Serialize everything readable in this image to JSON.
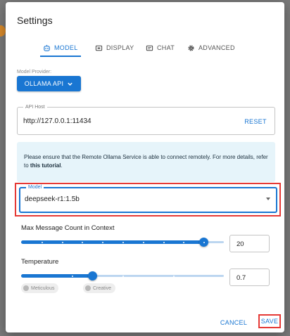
{
  "dialog": {
    "title": "Settings"
  },
  "tabs": [
    {
      "label": "MODEL",
      "icon": "robot-icon",
      "active": true
    },
    {
      "label": "DISPLAY",
      "icon": "monitor-icon",
      "active": false
    },
    {
      "label": "CHAT",
      "icon": "chat-icon",
      "active": false
    },
    {
      "label": "ADVANCED",
      "icon": "gear-icon",
      "active": false
    }
  ],
  "provider": {
    "label": "Model Provider:",
    "button_label": "OLLAMA API"
  },
  "api_host": {
    "legend": "API Host",
    "value": "http://127.0.0.1:11434",
    "reset_label": "RESET"
  },
  "info": {
    "text": "Please ensure that the Remote Ollama Service is able to connect remotely. For more details, refer to ",
    "link": "this tutorial",
    "suffix": "."
  },
  "model": {
    "legend": "Model",
    "value": "deepseek-r1:1.5b"
  },
  "context": {
    "label": "Max Message Count in Context",
    "value": "20",
    "fraction": 0.9
  },
  "temperature": {
    "label": "Temperature",
    "value": "0.7",
    "fraction": 0.35,
    "chips": [
      "Meticulous",
      "Creative"
    ]
  },
  "footer": {
    "cancel_label": "CANCEL",
    "save_label": "SAVE"
  },
  "colors": {
    "accent": "#1976d2",
    "highlight": "#e53935",
    "info_bg": "#e6f4fa"
  }
}
